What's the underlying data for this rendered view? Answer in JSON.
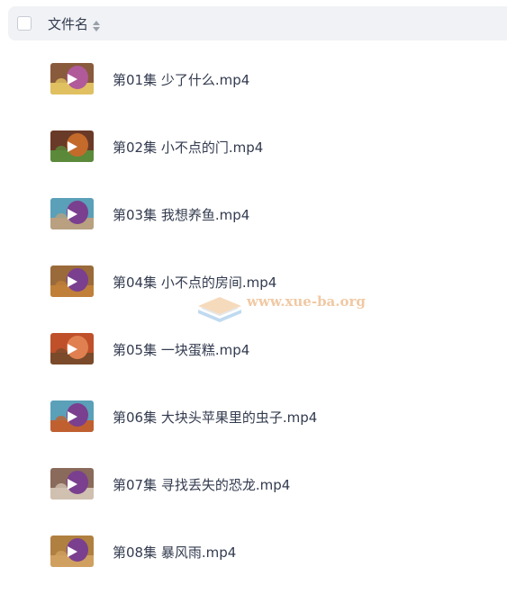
{
  "header": {
    "column_name": "文件名",
    "sort_icon": "sort-icon",
    "checkbox_icon": "checkbox-icon"
  },
  "files": [
    {
      "name": "第01集 少了什么.mp4"
    },
    {
      "name": "第02集 小不点的门.mp4"
    },
    {
      "name": "第03集 我想养鱼.mp4"
    },
    {
      "name": "第04集 小不点的房间.mp4"
    },
    {
      "name": "第05集 一块蛋糕.mp4"
    },
    {
      "name": "第06集 大块头苹果里的虫子.mp4"
    },
    {
      "name": "第07集 寻找丢失的恐龙.mp4"
    },
    {
      "name": "第08集 暴风雨.mp4"
    }
  ],
  "watermark": {
    "text": "www.xue-ba.org",
    "text_color": "#f0c9a4"
  },
  "colors": {
    "header_bg": "#f0f2f5",
    "text": "#333b4f",
    "thumb_purple": "#7a3f8f",
    "thumb_brown": "#7a4a2a"
  }
}
